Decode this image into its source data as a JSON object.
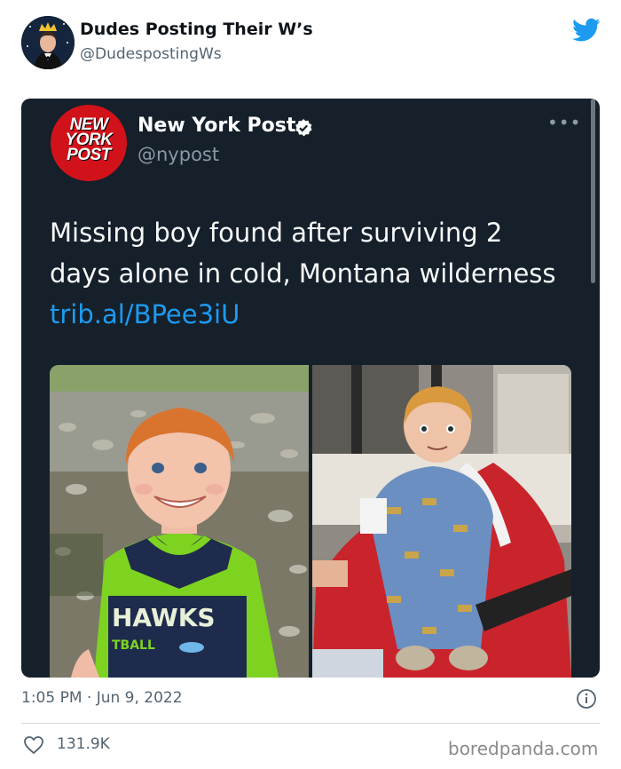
{
  "author": {
    "display_name": "Dudes Posting Their W’s",
    "handle": "@DudespostingWs"
  },
  "embedded_tweet": {
    "logo_text": [
      "NEW",
      "YORK",
      "POST"
    ],
    "display_name": "New York Post",
    "handle": "@nypost",
    "text": "Missing boy found after surviving 2 days alone in cold, Montana wilderness ",
    "link": "trib.al/BPee3iU",
    "jersey_text": "HAWKS",
    "jersey_subtext": "TBALL"
  },
  "footer": {
    "timestamp": "1:05 PM · Jun 9, 2022",
    "likes": "131.9K"
  },
  "watermark": "boredpanda.com",
  "colors": {
    "embed_bg": "#15202b",
    "link": "#1d9bf0",
    "twitter_blue": "#1d9bf0",
    "nyp_red": "#d1121a"
  },
  "icons": [
    "twitter-bird-icon",
    "verified-badge-icon",
    "more-icon",
    "info-icon",
    "heart-icon"
  ]
}
